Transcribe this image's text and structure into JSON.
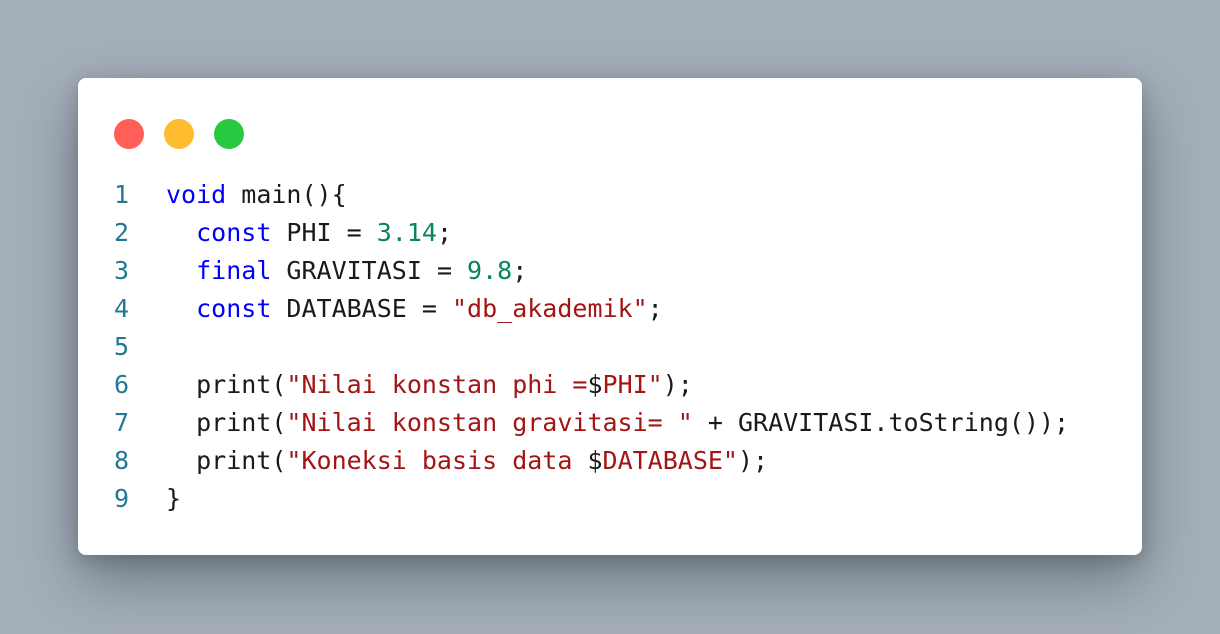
{
  "colors": {
    "background": "#a5afb9",
    "card": "#ffffff",
    "dot_red": "#ff5f57",
    "dot_yellow": "#febc2e",
    "dot_green": "#28c840",
    "line_number": "#237893",
    "keyword": "#0000ff",
    "number": "#098658",
    "string": "#a31515",
    "default": "#1a1a1a"
  },
  "window_controls": {
    "close": "red-circle-icon",
    "minimize": "yellow-circle-icon",
    "maximize": "green-circle-icon"
  },
  "code": {
    "language": "dart",
    "lines": [
      {
        "number": "1",
        "tokens": [
          {
            "text": "void",
            "type": "keyword"
          },
          {
            "text": " main(){",
            "type": "default"
          }
        ]
      },
      {
        "number": "2",
        "tokens": [
          {
            "text": "  ",
            "type": "default"
          },
          {
            "text": "const",
            "type": "keyword"
          },
          {
            "text": " PHI = ",
            "type": "default"
          },
          {
            "text": "3.14",
            "type": "number"
          },
          {
            "text": ";",
            "type": "default"
          }
        ]
      },
      {
        "number": "3",
        "tokens": [
          {
            "text": "  ",
            "type": "default"
          },
          {
            "text": "final",
            "type": "keyword"
          },
          {
            "text": " GRAVITASI = ",
            "type": "default"
          },
          {
            "text": "9.8",
            "type": "number"
          },
          {
            "text": ";",
            "type": "default"
          }
        ]
      },
      {
        "number": "4",
        "tokens": [
          {
            "text": "  ",
            "type": "default"
          },
          {
            "text": "const",
            "type": "keyword"
          },
          {
            "text": " DATABASE = ",
            "type": "default"
          },
          {
            "text": "\"db_akademik\"",
            "type": "string"
          },
          {
            "text": ";",
            "type": "default"
          }
        ]
      },
      {
        "number": "5",
        "tokens": []
      },
      {
        "number": "6",
        "tokens": [
          {
            "text": "  print(",
            "type": "default"
          },
          {
            "text": "\"Nilai konstan phi =",
            "type": "string"
          },
          {
            "text": "$",
            "type": "default"
          },
          {
            "text": "PHI\"",
            "type": "string"
          },
          {
            "text": ");",
            "type": "default"
          }
        ]
      },
      {
        "number": "7",
        "tokens": [
          {
            "text": "  print(",
            "type": "default"
          },
          {
            "text": "\"Nilai konstan gravitasi= \"",
            "type": "string"
          },
          {
            "text": " + GRAVITASI.toString());",
            "type": "default"
          }
        ]
      },
      {
        "number": "8",
        "tokens": [
          {
            "text": "  print(",
            "type": "default"
          },
          {
            "text": "\"Koneksi basis data ",
            "type": "string"
          },
          {
            "text": "$",
            "type": "default"
          },
          {
            "text": "DATABASE\"",
            "type": "string"
          },
          {
            "text": ");",
            "type": "default"
          }
        ]
      },
      {
        "number": "9",
        "tokens": [
          {
            "text": "}",
            "type": "default"
          }
        ]
      }
    ]
  }
}
